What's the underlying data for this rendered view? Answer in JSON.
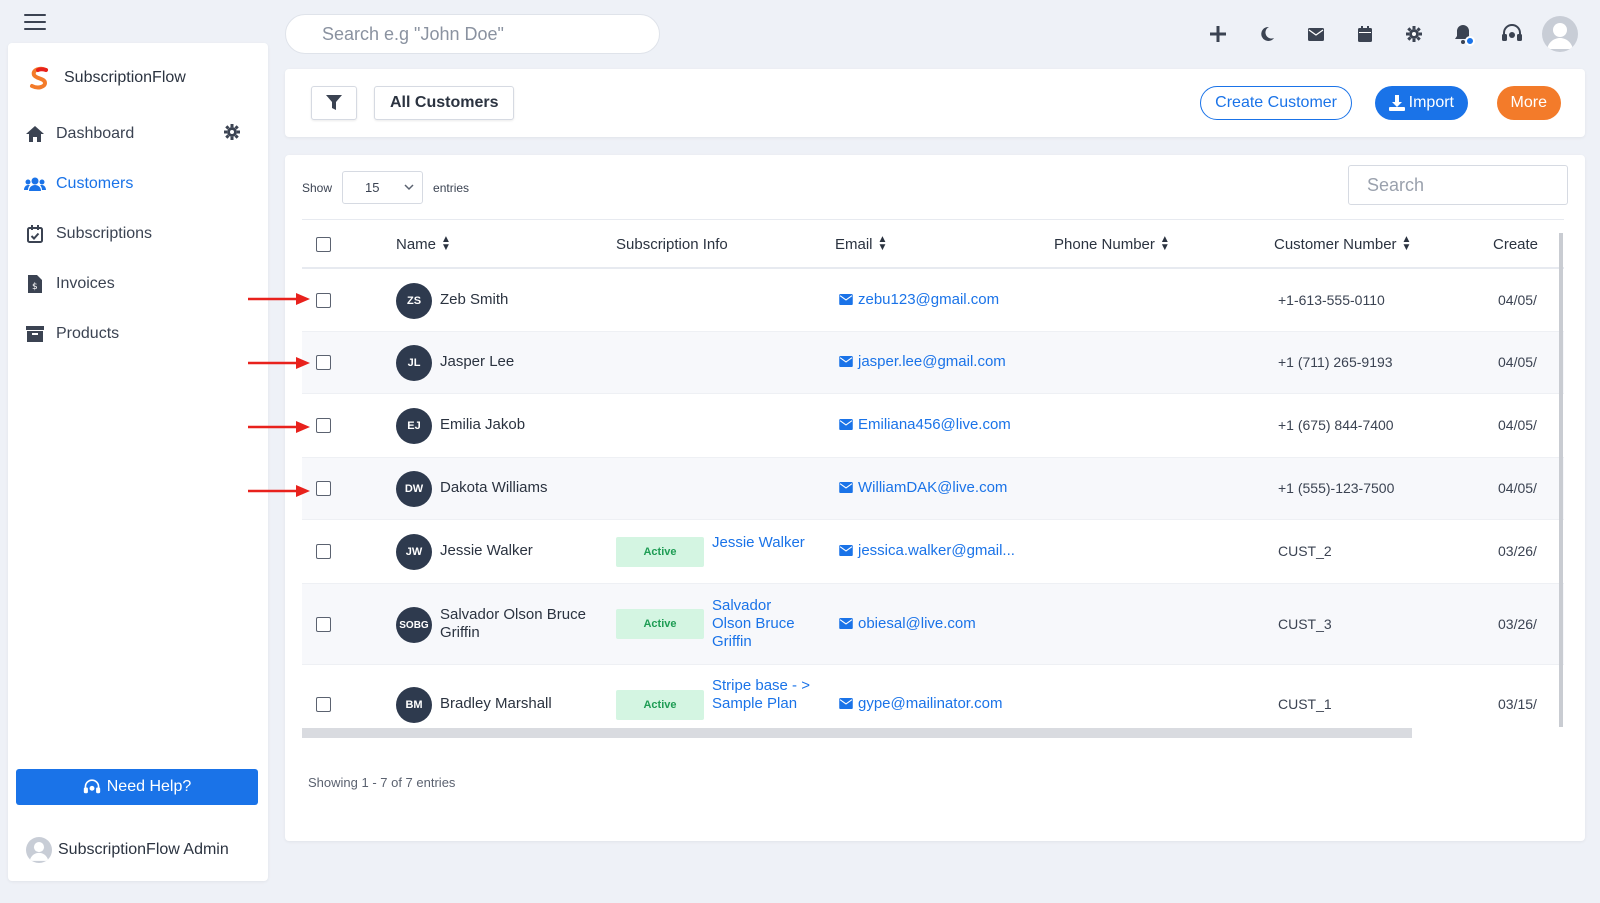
{
  "app": {
    "brand": "SubscriptionFlow"
  },
  "topbar": {
    "search_placeholder": "Search e.g \"John Doe\"",
    "icons": [
      "plus-icon",
      "moon-icon",
      "envelope-icon",
      "calendar-icon",
      "gear-icon",
      "bell-icon",
      "headset-icon"
    ]
  },
  "sidebar": {
    "items": [
      {
        "label": "Dashboard",
        "icon": "home-icon"
      },
      {
        "label": "Customers",
        "icon": "users-icon",
        "active": true
      },
      {
        "label": "Subscriptions",
        "icon": "calendar-check-icon"
      },
      {
        "label": "Invoices",
        "icon": "invoice-icon"
      },
      {
        "label": "Products",
        "icon": "archive-icon"
      }
    ],
    "help_label": "Need Help?",
    "admin_name": "SubscriptionFlow Admin"
  },
  "toolbar": {
    "view_label": "All Customers",
    "create_label": "Create Customer",
    "import_label": "Import",
    "more_label": "More"
  },
  "table": {
    "show_label": "Show",
    "entries_label": "entries",
    "page_length": "15",
    "search_placeholder": "Search",
    "columns": [
      "Name",
      "Subscription Info",
      "Email",
      "Phone Number",
      "Customer Number",
      "Create"
    ],
    "rows": [
      {
        "initials": "ZS",
        "name": "Zeb Smith",
        "status": "",
        "plan": "",
        "email": "zebu123@gmail.com",
        "customer_number": "+1-613-555-0110",
        "created": "04/05/"
      },
      {
        "initials": "JL",
        "name": "Jasper Lee",
        "status": "",
        "plan": "",
        "email": "jasper.lee@gmail.com",
        "customer_number": "+1 (711) 265-9193",
        "created": "04/05/"
      },
      {
        "initials": "EJ",
        "name": "Emilia Jakob",
        "status": "",
        "plan": "",
        "email": "Emiliana456@live.com",
        "customer_number": "+1 (675) 844-7400",
        "created": "04/05/"
      },
      {
        "initials": "DW",
        "name": "Dakota Williams",
        "status": "",
        "plan": "",
        "email": "WilliamDAK@live.com",
        "customer_number": "+1 (555)-123-7500",
        "created": "04/05/"
      },
      {
        "initials": "JW",
        "name": "Jessie Walker",
        "status": "Active",
        "plan": "Jessie Walker",
        "email": "jessica.walker@gmail...",
        "customer_number": "CUST_2",
        "created": "03/26/"
      },
      {
        "initials": "SOBG",
        "name": "Salvador Olson Bruce Griffin",
        "status": "Active",
        "plan": "Salvador Olson Bruce Griffin",
        "email": "obiesal@live.com",
        "customer_number": "CUST_3",
        "created": "03/26/"
      },
      {
        "initials": "BM",
        "name": "Bradley Marshall",
        "status": "Active",
        "plan": "Stripe base - > Sample Plan",
        "email": "gype@mailinator.com",
        "customer_number": "CUST_1",
        "created": "03/15/"
      }
    ],
    "info": "Showing 1 - 7 of 7 entries"
  },
  "colors": {
    "accent": "#1a73e8",
    "more": "#f37b2a",
    "active_badge_bg": "#d4f5e2",
    "active_badge_text": "#1f9d55",
    "annotation_arrow": "#e8211c"
  }
}
